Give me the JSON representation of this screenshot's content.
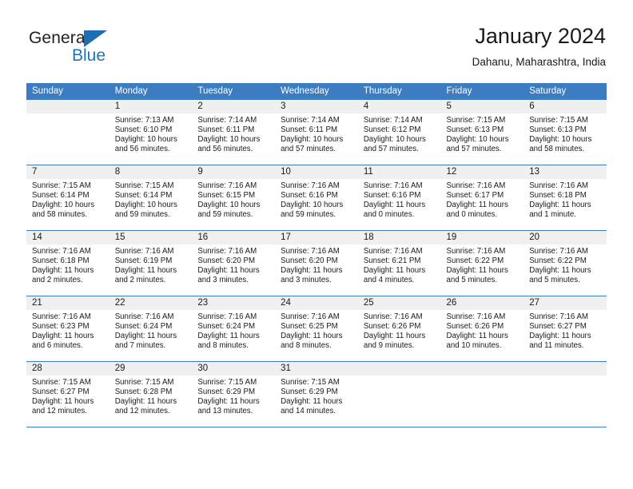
{
  "brand": {
    "name_top": "General",
    "name_bottom": "Blue",
    "triangle_color": "#1c6fb5",
    "blue_color": "#1c75bc"
  },
  "header": {
    "title": "January 2024",
    "subtitle": "Dahanu, Maharashtra, India"
  },
  "theme": {
    "header_bg": "#3c7cc0",
    "header_text": "#ffffff",
    "daynum_bg": "#f0f0f0",
    "grid_line": "#3c7cc0",
    "page_bg": "#ffffff"
  },
  "weekday_headers": [
    "Sunday",
    "Monday",
    "Tuesday",
    "Wednesday",
    "Thursday",
    "Friday",
    "Saturday"
  ],
  "weeks": [
    [
      {
        "day": "",
        "sunrise": "",
        "sunset": "",
        "daylight_line1": "",
        "daylight_line2": "",
        "blank": true
      },
      {
        "day": "1",
        "sunrise": "Sunrise: 7:13 AM",
        "sunset": "Sunset: 6:10 PM",
        "daylight_line1": "Daylight: 10 hours",
        "daylight_line2": "and 56 minutes."
      },
      {
        "day": "2",
        "sunrise": "Sunrise: 7:14 AM",
        "sunset": "Sunset: 6:11 PM",
        "daylight_line1": "Daylight: 10 hours",
        "daylight_line2": "and 56 minutes."
      },
      {
        "day": "3",
        "sunrise": "Sunrise: 7:14 AM",
        "sunset": "Sunset: 6:11 PM",
        "daylight_line1": "Daylight: 10 hours",
        "daylight_line2": "and 57 minutes."
      },
      {
        "day": "4",
        "sunrise": "Sunrise: 7:14 AM",
        "sunset": "Sunset: 6:12 PM",
        "daylight_line1": "Daylight: 10 hours",
        "daylight_line2": "and 57 minutes."
      },
      {
        "day": "5",
        "sunrise": "Sunrise: 7:15 AM",
        "sunset": "Sunset: 6:13 PM",
        "daylight_line1": "Daylight: 10 hours",
        "daylight_line2": "and 57 minutes."
      },
      {
        "day": "6",
        "sunrise": "Sunrise: 7:15 AM",
        "sunset": "Sunset: 6:13 PM",
        "daylight_line1": "Daylight: 10 hours",
        "daylight_line2": "and 58 minutes."
      }
    ],
    [
      {
        "day": "7",
        "sunrise": "Sunrise: 7:15 AM",
        "sunset": "Sunset: 6:14 PM",
        "daylight_line1": "Daylight: 10 hours",
        "daylight_line2": "and 58 minutes."
      },
      {
        "day": "8",
        "sunrise": "Sunrise: 7:15 AM",
        "sunset": "Sunset: 6:14 PM",
        "daylight_line1": "Daylight: 10 hours",
        "daylight_line2": "and 59 minutes."
      },
      {
        "day": "9",
        "sunrise": "Sunrise: 7:16 AM",
        "sunset": "Sunset: 6:15 PM",
        "daylight_line1": "Daylight: 10 hours",
        "daylight_line2": "and 59 minutes."
      },
      {
        "day": "10",
        "sunrise": "Sunrise: 7:16 AM",
        "sunset": "Sunset: 6:16 PM",
        "daylight_line1": "Daylight: 10 hours",
        "daylight_line2": "and 59 minutes."
      },
      {
        "day": "11",
        "sunrise": "Sunrise: 7:16 AM",
        "sunset": "Sunset: 6:16 PM",
        "daylight_line1": "Daylight: 11 hours",
        "daylight_line2": "and 0 minutes."
      },
      {
        "day": "12",
        "sunrise": "Sunrise: 7:16 AM",
        "sunset": "Sunset: 6:17 PM",
        "daylight_line1": "Daylight: 11 hours",
        "daylight_line2": "and 0 minutes."
      },
      {
        "day": "13",
        "sunrise": "Sunrise: 7:16 AM",
        "sunset": "Sunset: 6:18 PM",
        "daylight_line1": "Daylight: 11 hours",
        "daylight_line2": "and 1 minute."
      }
    ],
    [
      {
        "day": "14",
        "sunrise": "Sunrise: 7:16 AM",
        "sunset": "Sunset: 6:18 PM",
        "daylight_line1": "Daylight: 11 hours",
        "daylight_line2": "and 2 minutes."
      },
      {
        "day": "15",
        "sunrise": "Sunrise: 7:16 AM",
        "sunset": "Sunset: 6:19 PM",
        "daylight_line1": "Daylight: 11 hours",
        "daylight_line2": "and 2 minutes."
      },
      {
        "day": "16",
        "sunrise": "Sunrise: 7:16 AM",
        "sunset": "Sunset: 6:20 PM",
        "daylight_line1": "Daylight: 11 hours",
        "daylight_line2": "and 3 minutes."
      },
      {
        "day": "17",
        "sunrise": "Sunrise: 7:16 AM",
        "sunset": "Sunset: 6:20 PM",
        "daylight_line1": "Daylight: 11 hours",
        "daylight_line2": "and 3 minutes."
      },
      {
        "day": "18",
        "sunrise": "Sunrise: 7:16 AM",
        "sunset": "Sunset: 6:21 PM",
        "daylight_line1": "Daylight: 11 hours",
        "daylight_line2": "and 4 minutes."
      },
      {
        "day": "19",
        "sunrise": "Sunrise: 7:16 AM",
        "sunset": "Sunset: 6:22 PM",
        "daylight_line1": "Daylight: 11 hours",
        "daylight_line2": "and 5 minutes."
      },
      {
        "day": "20",
        "sunrise": "Sunrise: 7:16 AM",
        "sunset": "Sunset: 6:22 PM",
        "daylight_line1": "Daylight: 11 hours",
        "daylight_line2": "and 5 minutes."
      }
    ],
    [
      {
        "day": "21",
        "sunrise": "Sunrise: 7:16 AM",
        "sunset": "Sunset: 6:23 PM",
        "daylight_line1": "Daylight: 11 hours",
        "daylight_line2": "and 6 minutes."
      },
      {
        "day": "22",
        "sunrise": "Sunrise: 7:16 AM",
        "sunset": "Sunset: 6:24 PM",
        "daylight_line1": "Daylight: 11 hours",
        "daylight_line2": "and 7 minutes."
      },
      {
        "day": "23",
        "sunrise": "Sunrise: 7:16 AM",
        "sunset": "Sunset: 6:24 PM",
        "daylight_line1": "Daylight: 11 hours",
        "daylight_line2": "and 8 minutes."
      },
      {
        "day": "24",
        "sunrise": "Sunrise: 7:16 AM",
        "sunset": "Sunset: 6:25 PM",
        "daylight_line1": "Daylight: 11 hours",
        "daylight_line2": "and 8 minutes."
      },
      {
        "day": "25",
        "sunrise": "Sunrise: 7:16 AM",
        "sunset": "Sunset: 6:26 PM",
        "daylight_line1": "Daylight: 11 hours",
        "daylight_line2": "and 9 minutes."
      },
      {
        "day": "26",
        "sunrise": "Sunrise: 7:16 AM",
        "sunset": "Sunset: 6:26 PM",
        "daylight_line1": "Daylight: 11 hours",
        "daylight_line2": "and 10 minutes."
      },
      {
        "day": "27",
        "sunrise": "Sunrise: 7:16 AM",
        "sunset": "Sunset: 6:27 PM",
        "daylight_line1": "Daylight: 11 hours",
        "daylight_line2": "and 11 minutes."
      }
    ],
    [
      {
        "day": "28",
        "sunrise": "Sunrise: 7:15 AM",
        "sunset": "Sunset: 6:27 PM",
        "daylight_line1": "Daylight: 11 hours",
        "daylight_line2": "and 12 minutes."
      },
      {
        "day": "29",
        "sunrise": "Sunrise: 7:15 AM",
        "sunset": "Sunset: 6:28 PM",
        "daylight_line1": "Daylight: 11 hours",
        "daylight_line2": "and 12 minutes."
      },
      {
        "day": "30",
        "sunrise": "Sunrise: 7:15 AM",
        "sunset": "Sunset: 6:29 PM",
        "daylight_line1": "Daylight: 11 hours",
        "daylight_line2": "and 13 minutes."
      },
      {
        "day": "31",
        "sunrise": "Sunrise: 7:15 AM",
        "sunset": "Sunset: 6:29 PM",
        "daylight_line1": "Daylight: 11 hours",
        "daylight_line2": "and 14 minutes."
      },
      {
        "day": "",
        "sunrise": "",
        "sunset": "",
        "daylight_line1": "",
        "daylight_line2": "",
        "blank": true
      },
      {
        "day": "",
        "sunrise": "",
        "sunset": "",
        "daylight_line1": "",
        "daylight_line2": "",
        "blank": true
      },
      {
        "day": "",
        "sunrise": "",
        "sunset": "",
        "daylight_line1": "",
        "daylight_line2": "",
        "blank": true
      }
    ]
  ]
}
